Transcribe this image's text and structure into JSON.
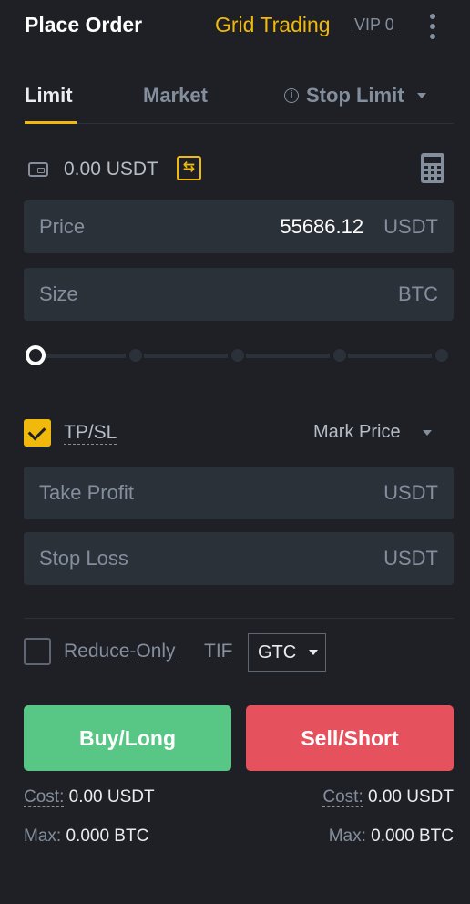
{
  "header": {
    "title": "Place Order",
    "grid_trading": "Grid Trading",
    "vip": "VIP 0"
  },
  "tabs": {
    "limit": "Limit",
    "market": "Market",
    "stop_limit": "Stop Limit",
    "active": "Limit"
  },
  "balance": {
    "amount": "0.00 USDT"
  },
  "price_field": {
    "label": "Price",
    "value": "55686.12",
    "unit": "USDT"
  },
  "size_field": {
    "label": "Size",
    "value": "",
    "unit": "BTC"
  },
  "slider": {
    "value_percent": 0
  },
  "tpsl": {
    "label": "TP/SL",
    "checked": true,
    "trigger": "Mark Price",
    "take_profit": {
      "label": "Take Profit",
      "unit": "USDT"
    },
    "stop_loss": {
      "label": "Stop Loss",
      "unit": "USDT"
    }
  },
  "options": {
    "reduce_only": "Reduce-Only",
    "reduce_only_checked": false,
    "tif_label": "TIF",
    "tif_value": "GTC"
  },
  "buttons": {
    "buy": "Buy/Long",
    "sell": "Sell/Short"
  },
  "stats": {
    "cost_label": "Cost:",
    "max_label": "Max:",
    "buy_cost": "0.00 USDT",
    "buy_max": "0.000 BTC",
    "sell_cost": "0.00 USDT",
    "sell_max": "0.000 BTC"
  },
  "colors": {
    "background": "#1e2026",
    "accent": "#f0b90b",
    "buy": "#58c684",
    "sell": "#e5525d",
    "field_bg": "#2b3139"
  }
}
